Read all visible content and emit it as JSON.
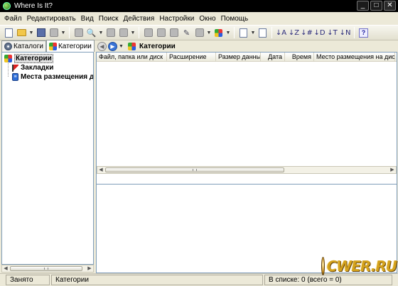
{
  "window": {
    "title": "Where Is It?",
    "buttons": {
      "minimize": "_",
      "maximize": "□",
      "close": "✕"
    }
  },
  "menu": [
    "Файл",
    "Редактировать",
    "Вид",
    "Поиск",
    "Действия",
    "Настройки",
    "Окно",
    "Помощь"
  ],
  "toolbar": {
    "icons": [
      "new-icon",
      "open-icon",
      "save-icon",
      "print-icon",
      "disk-icon",
      "search-icon",
      "cut-icon",
      "copy-icon",
      "paste-icon",
      "delete-icon",
      "edit-icon",
      "properties-icon",
      "category-icon",
      "view-icon",
      "export-icon",
      "sort-icon",
      "help-icon"
    ]
  },
  "left_panel": {
    "tabs": [
      {
        "label": "Каталоги",
        "icon": "disc-icon",
        "active": false
      },
      {
        "label": "Категории",
        "icon": "categories-icon",
        "active": true
      }
    ],
    "tree": [
      {
        "label": "Категории",
        "icon": "categories-icon",
        "selected": true
      },
      {
        "label": "Закладки",
        "icon": "bookmark-flag-icon",
        "selected": false
      },
      {
        "label": "Места размещения дис",
        "icon": "places-icon",
        "selected": false
      }
    ]
  },
  "right_panel": {
    "nav_title": "Категории",
    "columns": [
      "Файл, папка или диск",
      "Расширение",
      "Размер данных",
      "Дата",
      "Время",
      "Место размещения на диске"
    ],
    "rows": []
  },
  "statusbar": {
    "status": "Занято",
    "section": "Категории",
    "count": "В списке: 0 (всего = 0)"
  },
  "watermark": {
    "text": "CWER.RU"
  }
}
